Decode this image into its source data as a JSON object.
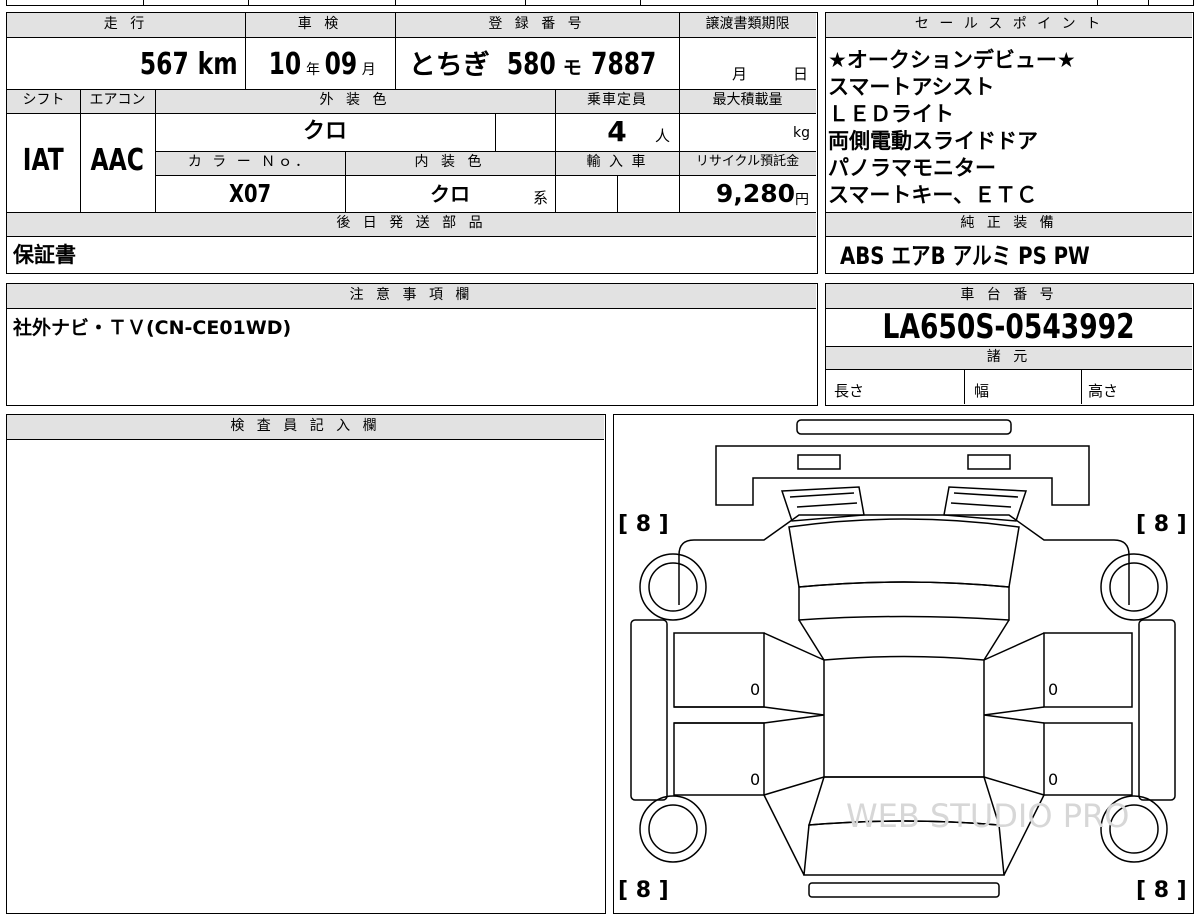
{
  "top": {
    "mileage_label": "走 行",
    "mileage_value": "567",
    "mileage_unit": "km",
    "inspection_label": "車 検",
    "inspection_year": "10",
    "inspection_year_unit": "年",
    "inspection_month": "09",
    "inspection_month_unit": "月",
    "registration_label": "登 録 番 号",
    "registration_region": "とちぎ",
    "registration_number": "580",
    "registration_kana": "モ",
    "registration_serial": "7887",
    "transfer_label": "譲渡書類期限",
    "transfer_month_unit": "月",
    "transfer_day_unit": "日"
  },
  "row2": {
    "shift_label": "シフト",
    "aircon_label": "エアコン",
    "exterior_label": "外 装 色",
    "capacity_label": "乗車定員",
    "maxload_label": "最大積載量",
    "shift_value": "IAT",
    "aircon_value": "AAC",
    "exterior_value": "クロ",
    "capacity_value": "4",
    "capacity_unit": "人",
    "maxload_unit": "kg",
    "color_no_label": "カ ラ ー Ｎｏ．",
    "interior_label": "内 装 色",
    "import_label": "輸 入 車",
    "recycle_label": "リサイクル預託金",
    "color_no_value": "X07",
    "interior_value": "クロ",
    "interior_unit": "系",
    "recycle_value": "9,280",
    "recycle_unit": "円"
  },
  "later_parts": {
    "label": "後 日 発 送 部 品",
    "value": "保証書"
  },
  "notes": {
    "label": "注 意 事 項 欄",
    "value": "社外ナビ・ＴＶ(CN-CE01WD)"
  },
  "inspector": {
    "label": "検 査 員 記 入 欄"
  },
  "sales_points": {
    "label": "セ ー ル ス ポ イ ン ト",
    "items": [
      "★オークションデビュー★",
      "スマートアシスト",
      "ＬＥＤライト",
      "両側電動スライドドア",
      "パノラマモニター",
      "スマートキー、ＥＴＣ"
    ]
  },
  "genuine": {
    "label": "純 正 装 備",
    "value": "ABS エアB アルミ PS PW"
  },
  "chassis": {
    "label": "車 台 番 号",
    "value": "LA650S-0543992"
  },
  "specs": {
    "label": "諸 元",
    "length_label": "長さ",
    "width_label": "幅",
    "height_label": "高さ"
  },
  "diagram": {
    "tire_tl": "[ 8 ]",
    "tire_tr": "[ 8 ]",
    "tire_bl": "[ 8 ]",
    "tire_br": "[ 8 ]",
    "door_fl": "0",
    "door_fr": "0",
    "door_rl": "0",
    "door_rr": "0",
    "watermark": "WEB STUDIO PRO"
  }
}
